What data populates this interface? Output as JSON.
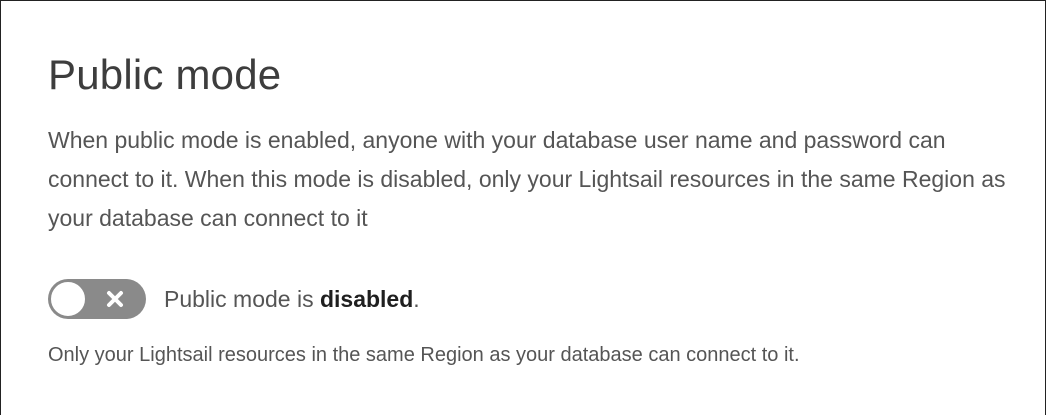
{
  "section": {
    "title": "Public mode",
    "description": "When public mode is enabled, anyone with your database user name and password can connect to it. When this mode is disabled, only your Lightsail resources in the same Region as your database can connect to it"
  },
  "toggle": {
    "state": "off",
    "icon": "close-icon",
    "status_prefix": "Public mode is ",
    "status_value": "disabled",
    "status_suffix": "."
  },
  "note": "Only your Lightsail resources in the same Region as your database can connect to it.",
  "colors": {
    "toggle_off_track": "#8a8a8a",
    "title_text": "#3d3d3d",
    "body_text": "#555555"
  }
}
